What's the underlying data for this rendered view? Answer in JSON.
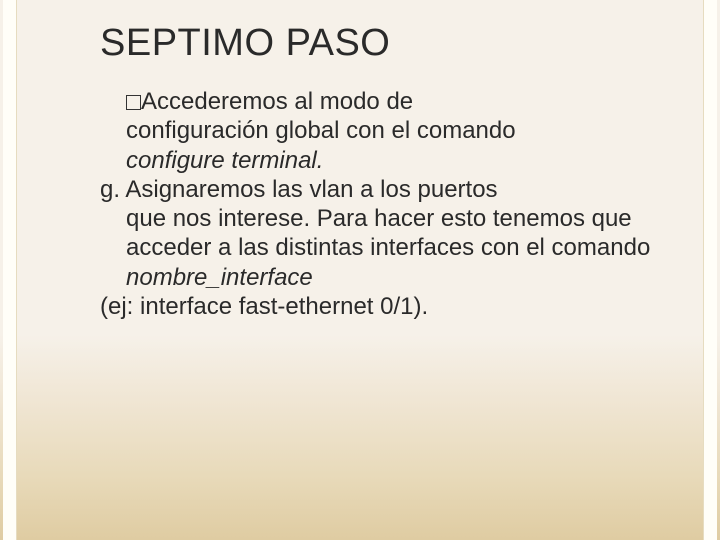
{
  "slide": {
    "title": "SEPTIMO PASO",
    "para1_a": "Accederemos al modo de",
    "para1_b": "configuración global con el comando",
    "para1_c": "configure terminal.",
    "para2_a": "g. Asignaremos las vlan a los puertos",
    "para2_b": "que nos interese. Para hacer esto tenemos que acceder a las distintas interfaces con el comando",
    "para2_c": "nombre_interface",
    "para3": "(ej: interface fast-ethernet 0/1)."
  }
}
